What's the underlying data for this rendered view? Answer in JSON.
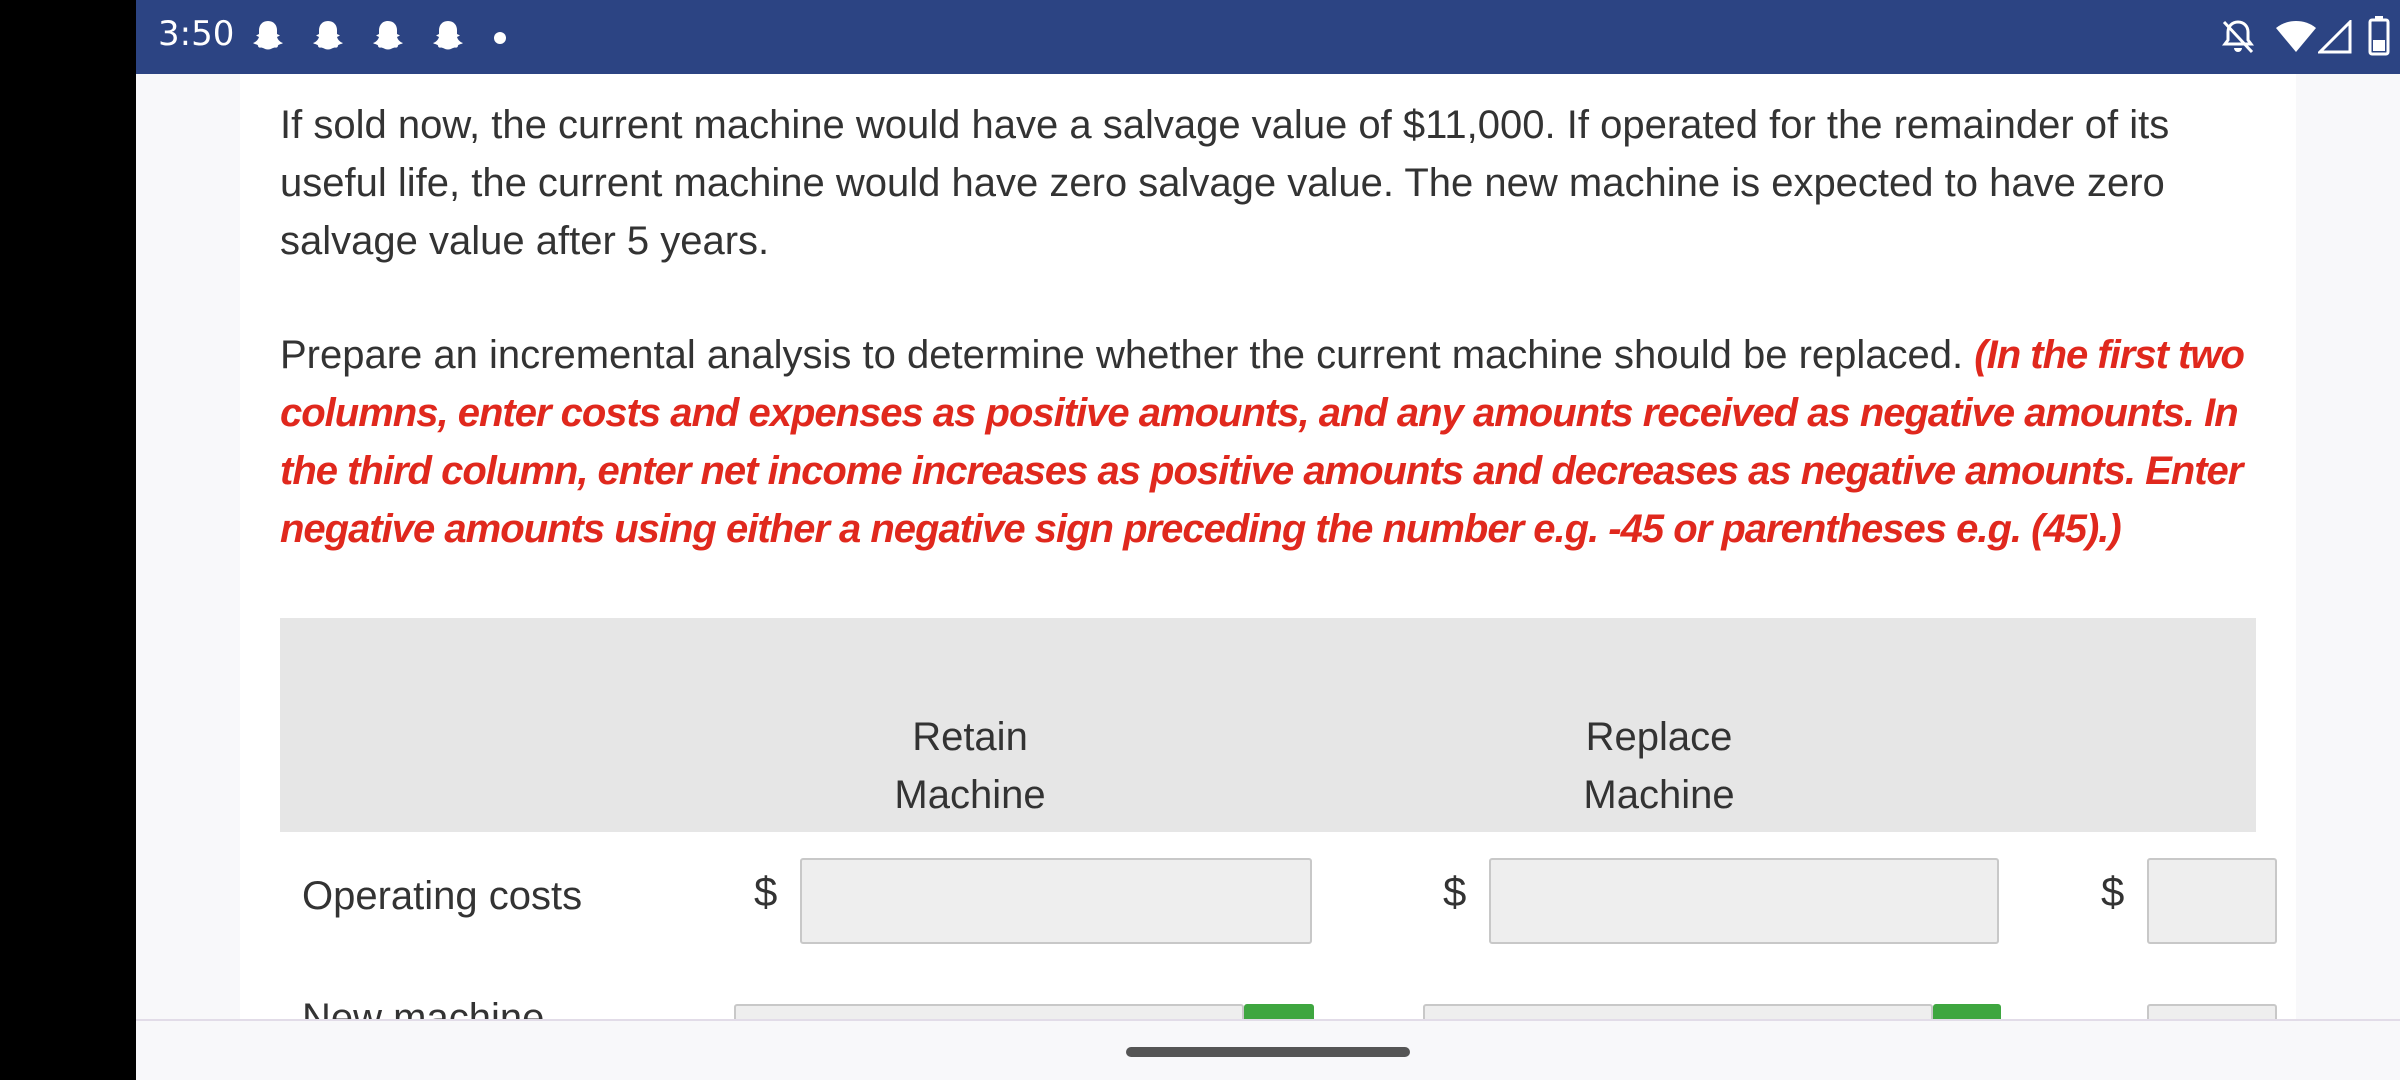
{
  "status_bar": {
    "time": "3:50",
    "notification_icons": [
      "snapchat-icon",
      "snapchat-icon",
      "snapchat-icon",
      "snapchat-icon"
    ],
    "right_icons": [
      "notifications-off-icon",
      "wifi-icon",
      "signal-icon",
      "battery-icon"
    ],
    "background": "#2c4483"
  },
  "content": {
    "paragraph1": "If sold now, the current machine would have a salvage value of $11,000. If operated for the remainder of its useful life, the current machine would have zero salvage value. The new machine is expected to have zero salvage value after 5 years.",
    "paragraph2_plain": "Prepare an incremental analysis to determine whether the current machine should be replaced. ",
    "paragraph2_instruction": "(In the first two columns, enter costs and expenses as positive amounts, and any amounts received as negative amounts.  In the third column, enter net income increases as positive amounts and decreases as negative amounts. Enter negative amounts using either a negative sign preceding the number e.g. -45 or parentheses e.g. (45).)",
    "instruction_color": "#e0281d"
  },
  "table": {
    "columns": [
      {
        "line1": "Retain",
        "line2": "Machine"
      },
      {
        "line1": "Replace",
        "line2": "Machine"
      }
    ],
    "rows": [
      {
        "label": "Operating costs",
        "currency": "$",
        "values": [
          "",
          "",
          ""
        ]
      },
      {
        "label": "New machine",
        "values": [
          "",
          "",
          ""
        ]
      }
    ],
    "accent": "#3ea640"
  }
}
